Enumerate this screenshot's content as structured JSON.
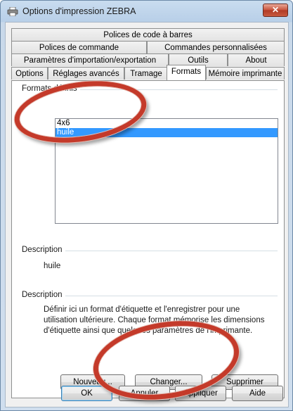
{
  "window": {
    "title": "Options d'impression ZEBRA",
    "close_label": "✕"
  },
  "tabs": {
    "row1": [
      "Polices de code à barres"
    ],
    "row2": [
      "Polices de commande",
      "Commandes personnalisées"
    ],
    "row3": [
      "Paramètres d'importation/exportation",
      "Outils",
      "About"
    ],
    "row4": [
      "Options",
      "Réglages avancés",
      "Tramage",
      "Formats",
      "Mémoire imprimante"
    ],
    "active": "Formats"
  },
  "formats": {
    "group_label": "Formats définis",
    "items": [
      "4x6",
      "huile"
    ],
    "selected": "huile"
  },
  "description1": {
    "label": "Description",
    "value": "huile"
  },
  "description2": {
    "label": "Description",
    "text": "Définir ici un format d'étiquette et l'enregistrer pour une utilisation ultérieure. Chaque format mémorise les dimensions d'étiquette ainsi que quelques paramètres de l'imprimante."
  },
  "panel_buttons": {
    "new": "Nouveau...",
    "change": "Changer...",
    "delete": "Supprimer"
  },
  "dialog_buttons": {
    "ok": "OK",
    "cancel": "Annuler",
    "apply": "Appliquer",
    "help": "Aide"
  },
  "colors": {
    "selection": "#3399ff",
    "annotation": "#c43a2a"
  }
}
